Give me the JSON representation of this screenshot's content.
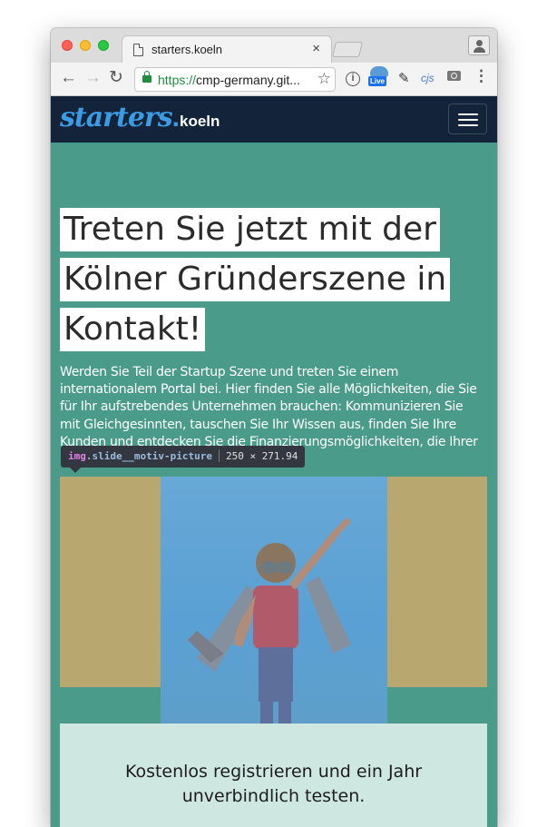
{
  "browser": {
    "tab_title": "starters.koeln",
    "tab_close": "×",
    "url_secure": "https://",
    "url_rest": "cmp-germany.git...",
    "back": "←",
    "forward": "→",
    "reload": "↻",
    "star": "☆",
    "ext_info": "i",
    "ext_live_badge": "Live",
    "ext_pen": "✎",
    "ext_cjs": "cjs",
    "menu_dots": "⋮"
  },
  "site": {
    "logo_script": "starters",
    "logo_dot": ".",
    "logo_city": "koeln",
    "heading_lines": [
      "Treten Sie jetzt mit der",
      "Kölner Gründerszene in",
      "Kontakt!"
    ],
    "intro": "Werden Sie Teil der Startup Szene und treten Sie einem internationalem Portal bei. Hier finden Sie alle Möglichkeiten, die Sie für Ihr aufstrebendes Unternehmen brauchen: Kommunizieren Sie mit Gleichgesinnten, tauschen Sie Ihr Wissen aus, finden Sie Ihre Kunden und entdecken Sie die Finanzierungsmöglichkeiten, die Ihrer Geschäftsidee den nötigen Boost",
    "cta_line1": "Kostenlos registrieren und ein Jahr",
    "cta_line2": "unverbindlich testen."
  },
  "devtools_tooltip": {
    "tag": "img",
    "class_name": ".slide__motiv-picture",
    "dimensions": "250 × 271.94"
  },
  "colors": {
    "nav_bg": "#13233a",
    "page_bg": "#4a9b8a",
    "logo_blue": "#3b9ce4",
    "slide_bg": "#b8a76f",
    "cta_bg": "#cfe7e1"
  },
  "icons": [
    "page-icon",
    "lock-icon",
    "star-icon",
    "info-icon",
    "live-extension-icon",
    "pen-icon",
    "camera-icon",
    "profile-icon",
    "hamburger-menu-icon"
  ]
}
